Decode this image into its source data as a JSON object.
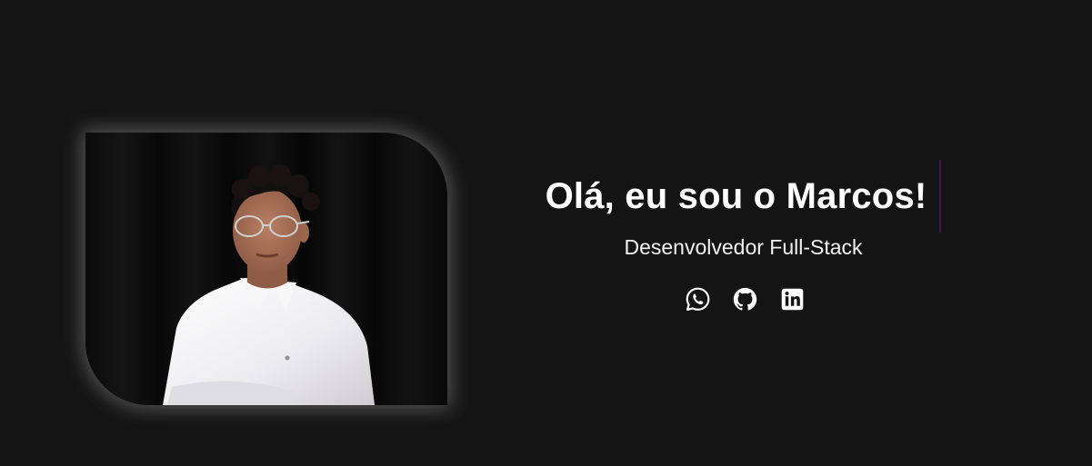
{
  "hero": {
    "title": "Olá, eu sou o Marcos!",
    "subtitle": "Desenvolvedor Full-Stack",
    "photo": {
      "description": "profile-photo"
    },
    "socials": [
      {
        "name": "WhatsApp",
        "icon": "whatsapp-icon"
      },
      {
        "name": "GitHub",
        "icon": "github-icon"
      },
      {
        "name": "LinkedIn",
        "icon": "linkedin-icon"
      }
    ]
  },
  "colors": {
    "background": "#141414",
    "text": "#ffffff",
    "caret": "#3a1f4a"
  }
}
